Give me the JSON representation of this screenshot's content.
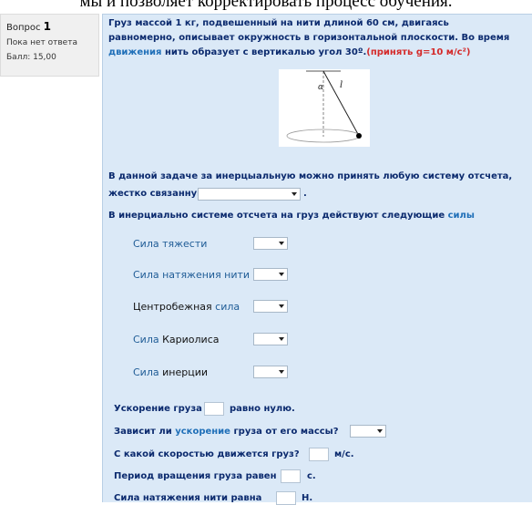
{
  "header_text": "мы и позволяет корректировать процесс обучения.",
  "info": {
    "question_label": "Вопрос",
    "question_number": "1",
    "status": "Пока нет ответа",
    "score": "Балл: 15,00"
  },
  "problem": {
    "line1": "Груз массой 1 кг,  подвешенный на нити длиной 60 см, двигаясь",
    "line2": "равномерно, описывает окружность в горизонтальной плоскости. Во время",
    "line3_blue": "движения",
    "line3_rest": " нить образует с вертикалью угол 30º.",
    "line3_red": "(принять g=10 м/с²)"
  },
  "figure": {
    "angle_label": "α",
    "length_label": "l"
  },
  "inertial": {
    "line1": "В данной задаче за инерцыальную можно принять любую систему отсчета,",
    "line2": "жестко связанную с",
    "line2_end": ".",
    "line3": "В инерциально системе отсчета на груз действуют следующие",
    "line3_blue": "силы"
  },
  "forces": [
    {
      "label": "Сила тяжести"
    },
    {
      "label": "Сила натяжения нити"
    },
    {
      "label_black": "Центробежная",
      "label_blue": "сила"
    },
    {
      "label_blue": "Сила",
      "label_black": "Кариолиса"
    },
    {
      "label_blue": "Сила",
      "label_black": "инерции"
    }
  ],
  "questions": {
    "q1_a": "Ускорение груза",
    "q1_b": "равно нулю.",
    "q2_a": "Зависит ли",
    "q2_b": "ускорение",
    "q2_c": "груза от его массы?",
    "q3_a": "С какой  скоростью движется груз?",
    "q3_b": "м/с.",
    "q4_a": "Период вращения груза равен",
    "q4_b": "с.",
    "q5_a": "Сила натяжения нити равна",
    "q5_b": "Н."
  }
}
